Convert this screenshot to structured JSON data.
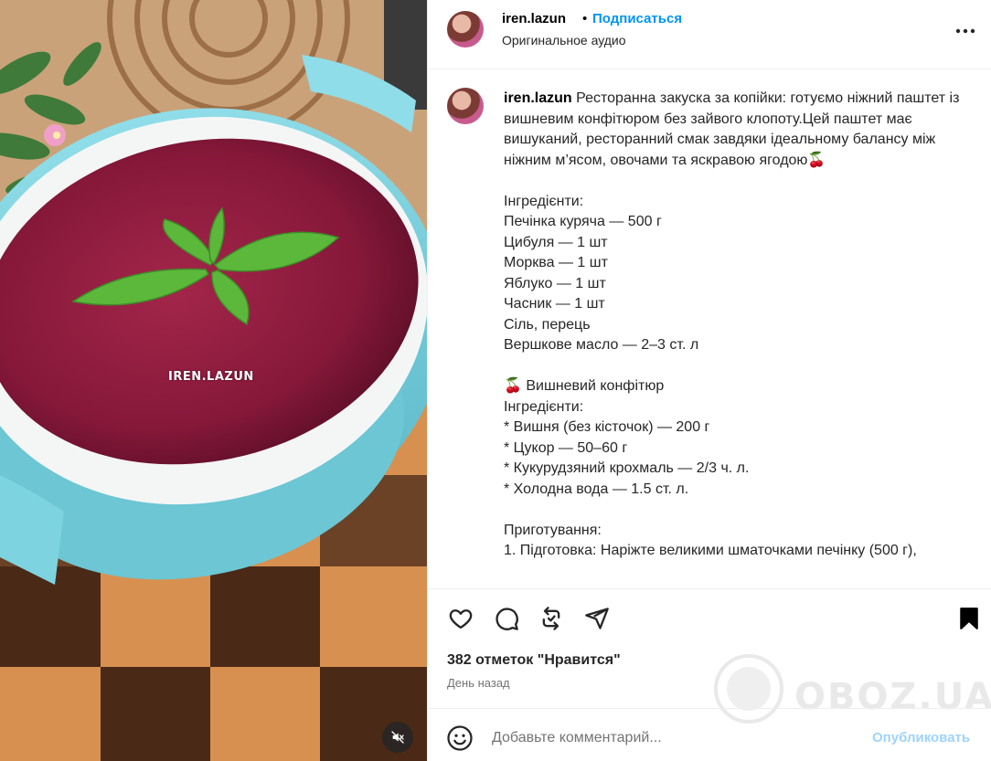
{
  "media": {
    "watermark": "IREN.LAZUN",
    "mute_icon": "speaker-muted-icon"
  },
  "header": {
    "username": "iren.lazun",
    "separator": "•",
    "follow_label": "Подписаться",
    "audio_label": "Оригинальное аудио",
    "more_icon": "more-horizontal-icon"
  },
  "caption": {
    "username": "iren.lazun",
    "text": " Ресторанна закуска за копійки: готуємо ніжний паштет із вишневим конфітюром без зайвого клопоту.Цей паштет має вишуканий, ресторанний смак завдяки ідеальному балансу між ніжним м’ясом, овочами та яскравою ягодою🍒\n\nІнгредієнти:\nПечінка куряча — 500 г\nЦибуля — 1 шт\nМорква — 1 шт\nЯблуко — 1 шт\nЧасник — 1 шт\nСіль, перець\nВершкове масло — 2–3 ст. л\n\n🍒 Вишневий конфітюр\nІнгредієнти:\n* Вишня (без кісточок) — 200 г\n* Цукор — 50–60 г\n* Кукурудзяний крохмаль — 2/3 ч. л.\n* Холодна вода — 1.5 ст. л.\n\nПриготування:\n1. Підготовка: Наріжте великими шматочками печінку (500 г),"
  },
  "actions": {
    "like_icon": "heart-icon",
    "comment_icon": "comment-icon",
    "share_icon": "repost-icon",
    "send_icon": "send-icon",
    "save_icon": "bookmark-icon"
  },
  "likes_text": "382 отметок \"Нравится\"",
  "time_text": "День назад",
  "comment": {
    "emoji_icon": "emoji-icon",
    "placeholder": "Добавьте комментарий...",
    "post_label": "Опубликовать"
  },
  "site_watermark": {
    "text": "OBOZ.UA"
  },
  "colors": {
    "link_blue": "#0095f6",
    "post_disabled": "#9ed3fb",
    "muted_text": "#737373",
    "pate": "#8e1a3c",
    "bowl": "#7dd3e0"
  }
}
